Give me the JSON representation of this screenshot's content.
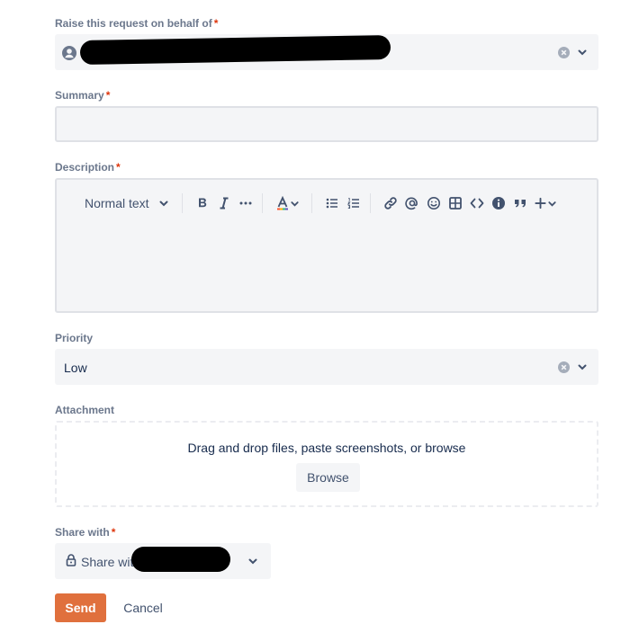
{
  "fields": {
    "on_behalf": {
      "label": "Raise this request on behalf of",
      "required_mark": "*",
      "value": ""
    },
    "summary": {
      "label": "Summary",
      "required_mark": "*",
      "value": ""
    },
    "description": {
      "label": "Description",
      "required_mark": "*",
      "toolbar": {
        "text_style": "Normal text",
        "buttons": [
          "bold-icon",
          "italic-icon",
          "more-icon",
          "text-color-icon",
          "bullet-list-icon",
          "numbered-list-icon",
          "link-icon",
          "mention-icon",
          "emoji-icon",
          "table-icon",
          "code-icon",
          "info-icon",
          "quote-icon",
          "insert-icon"
        ]
      },
      "value": ""
    },
    "priority": {
      "label": "Priority",
      "value": "Low"
    },
    "attachment": {
      "label": "Attachment",
      "dropzone_text": "Drag and drop files, paste screenshots, or browse",
      "browse_label": "Browse"
    },
    "share_with": {
      "label": "Share with",
      "required_mark": "*",
      "value": "Share wit"
    }
  },
  "actions": {
    "send_label": "Send",
    "cancel_label": "Cancel"
  },
  "colors": {
    "primary": "#e0703d",
    "required": "#de350b",
    "label": "#6b778c",
    "field_bg": "#f4f5f7"
  }
}
